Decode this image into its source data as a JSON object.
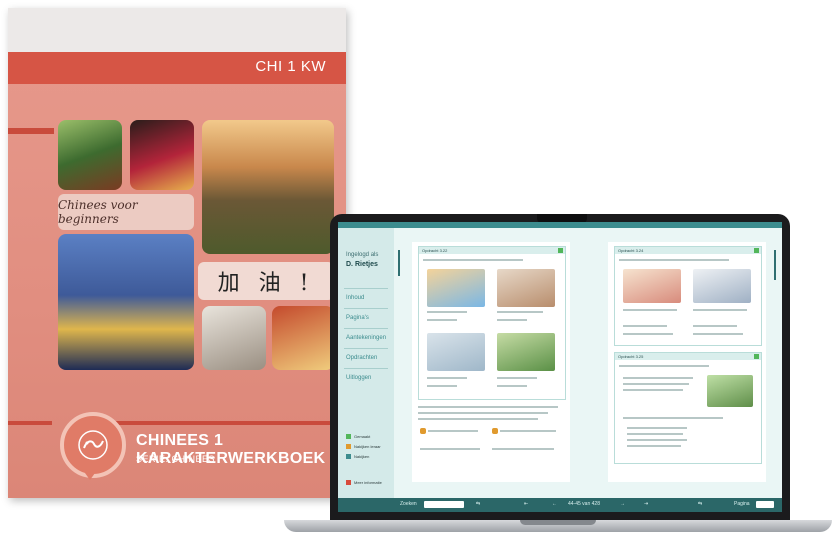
{
  "book": {
    "code": "CHI 1 KW",
    "subtitle": "Chinees voor beginners",
    "slogan": "加 油 !",
    "title": "CHINEES 1 KARAKTERWERKBOEK",
    "series": "SERIE: CHINEES"
  },
  "app": {
    "user_label": "Ingelogd als",
    "user_name": "D. Rietjes",
    "nav": [
      "Inhoud",
      "Pagina's",
      "Aantekeningen",
      "Opdrachten",
      "Uitloggen"
    ],
    "legend": [
      {
        "label": "Gemaakt",
        "color": "#52b65a"
      },
      {
        "label": "Nakijken leraar",
        "color": "#e09a2e"
      },
      {
        "label": "Nakijken",
        "color": "#3c8c8e"
      }
    ],
    "info_label": "Meer informatie",
    "left_page_card": "Opdracht 3.22",
    "right_page_card_1": "Opdracht 3.24",
    "right_page_card_2": "Opdracht 3.25",
    "bottom": {
      "search_label": "Zoeken",
      "page_indicator": "44-45 van 428",
      "page_label": "Pagina"
    },
    "colors": {
      "accent": "#3c8c8e",
      "sidebar": "#d4eae9",
      "bottom_bar": "#2b6768"
    }
  }
}
